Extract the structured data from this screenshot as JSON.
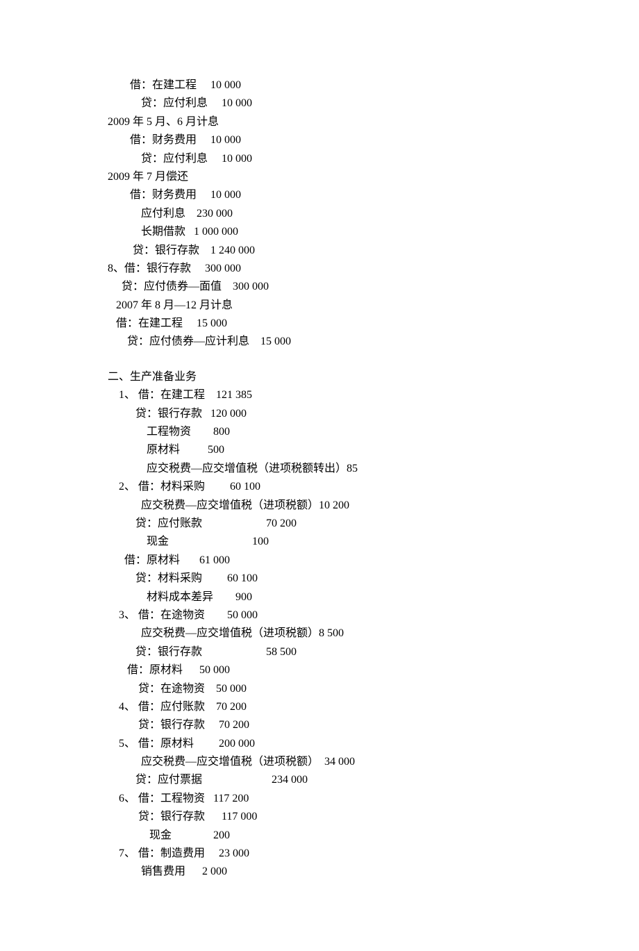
{
  "lines": {
    "l1": "        借：在建工程     10 000",
    "l2": "            贷：应付利息     10 000",
    "l3": "2009 年 5 月、6 月计息",
    "l4": "        借：财务费用     10 000",
    "l5": "            贷：应付利息     10 000",
    "l6": "2009 年 7 月偿还",
    "l7": "        借：财务费用     10 000",
    "l8": "            应付利息    230 000",
    "l9": "            长期借款   1 000 000",
    "l10": "         贷：银行存款    1 240 000",
    "l11": "8、借：银行存款     300 000",
    "l12": "     贷：应付债券—面值    300 000",
    "l13": "   2007 年 8 月—12 月计息",
    "l14": "   借：在建工程     15 000",
    "l15": "       贷：应付债券—应计利息    15 000",
    "section2": "二、生产准备业务",
    "l16": "    1、 借：在建工程    121 385",
    "l17": "          贷：银行存款   120 000",
    "l18": "              工程物资        800",
    "l19": "              原材料          500",
    "l20": "              应交税费—应交增值税（进项税额转出）85",
    "l21": "    2、 借：材料采购         60 100",
    "l22": "            应交税费—应交增值税（进项税额）10 200",
    "l23": "          贷：应付账款                       70 200",
    "l24": "              现金                              100",
    "l25": "      借：原材料       61 000",
    "l26": "          贷：材料采购         60 100",
    "l27": "              材料成本差异        900",
    "l28": "    3、 借：在途物资        50 000",
    "l29": "            应交税费—应交增值税（进项税额）8 500",
    "l30": "          贷：银行存款                       58 500",
    "l31": "       借：原材料      50 000",
    "l32": "           贷：在途物资    50 000",
    "l33": "    4、 借：应付账款    70 200",
    "l34": "           贷：银行存款     70 200",
    "l35": "    5、 借：原材料         200 000",
    "l36": "            应交税费—应交增值税（进项税额）  34 000",
    "l37": "          贷：应付票据                         234 000",
    "l38": "    6、 借：工程物资   117 200",
    "l39": "           贷：银行存款      117 000",
    "l40": "               现金               200",
    "l41": "    7、 借：制造费用     23 000",
    "l42": "            销售费用      2 000"
  }
}
